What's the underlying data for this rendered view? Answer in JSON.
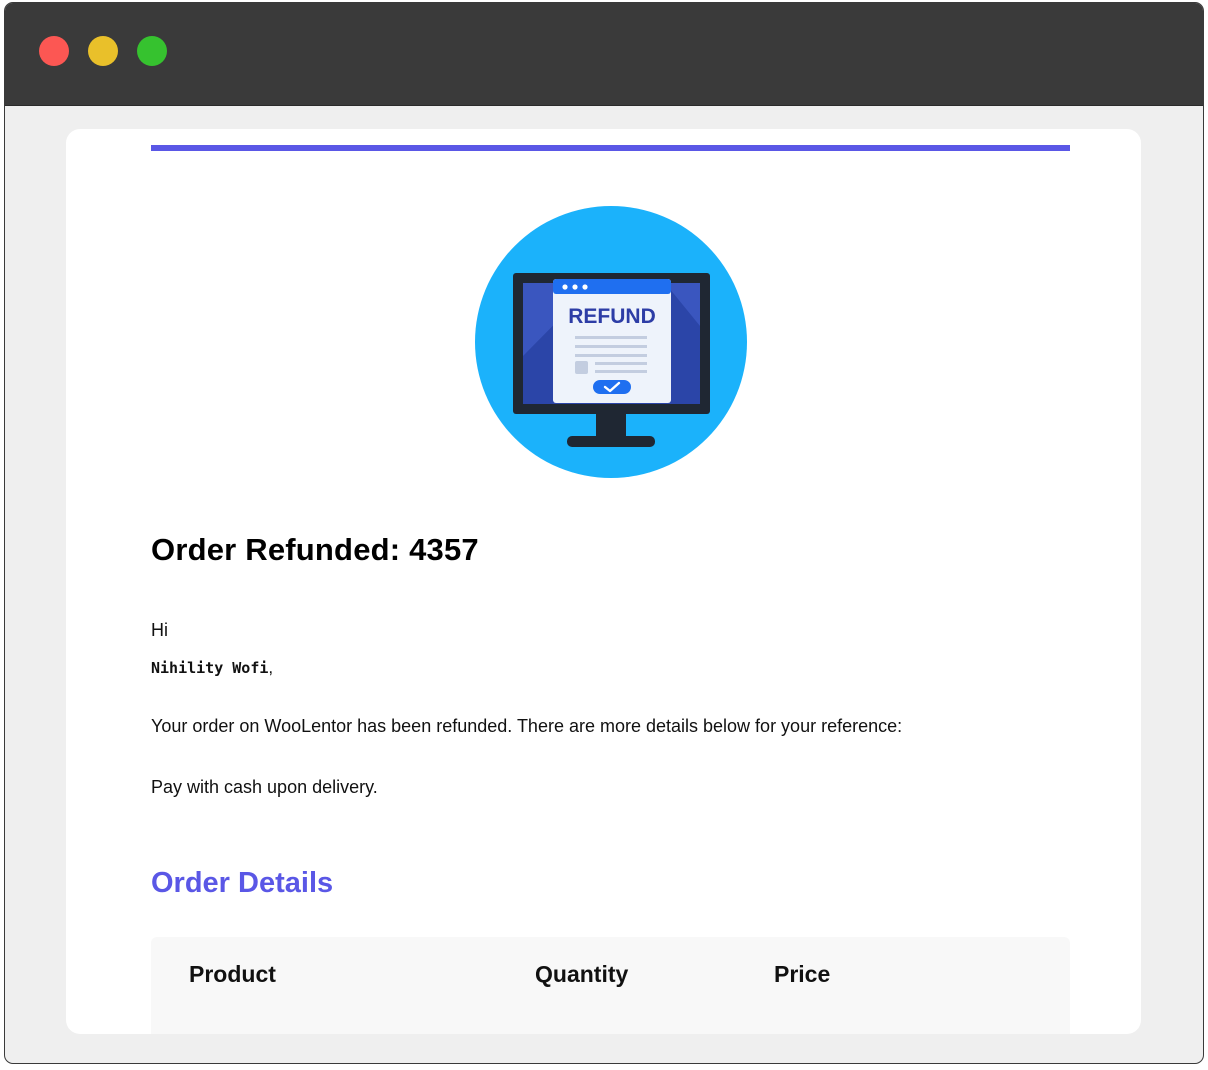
{
  "window": {
    "controls": [
      "close",
      "minimize",
      "maximize"
    ]
  },
  "email": {
    "accent_color": "#5a57e6",
    "hero_icon": "refund-monitor-icon",
    "hero_label": "REFUND",
    "title": "Order Refunded: 4357",
    "greeting": "Hi",
    "customer_name": "Nihility Wofi",
    "name_suffix": ",",
    "message": "Your order on WooLentor has been refunded. There are more details below for your reference:",
    "payment_note": "Pay with cash upon delivery.",
    "section_title": "Order Details",
    "table": {
      "headers": [
        "Product",
        "Quantity",
        "Price"
      ]
    }
  }
}
